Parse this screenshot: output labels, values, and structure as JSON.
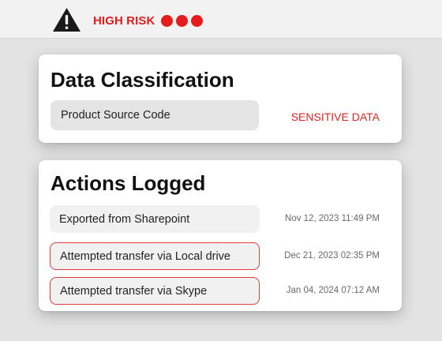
{
  "header": {
    "warning_icon": "warning-triangle-icon",
    "risk_label": "HIGH RISK",
    "risk_dots": 3,
    "risk_color": "#e61c1c"
  },
  "classification": {
    "title": "Data Classification",
    "item": "Product Source Code",
    "tag": "SENSITIVE DATA"
  },
  "actions": {
    "title": "Actions Logged",
    "items": [
      {
        "label": "Exported from Sharepoint",
        "date": "Nov 12, 2023 11:49 PM",
        "flagged": false
      },
      {
        "label": "Attempted transfer via Local drive",
        "date": "Dec 21, 2023 02:35 PM",
        "flagged": true
      },
      {
        "label": "Attempted transfer via Skype",
        "date": "Jan 04, 2024 07:12 AM",
        "flagged": true
      }
    ]
  }
}
